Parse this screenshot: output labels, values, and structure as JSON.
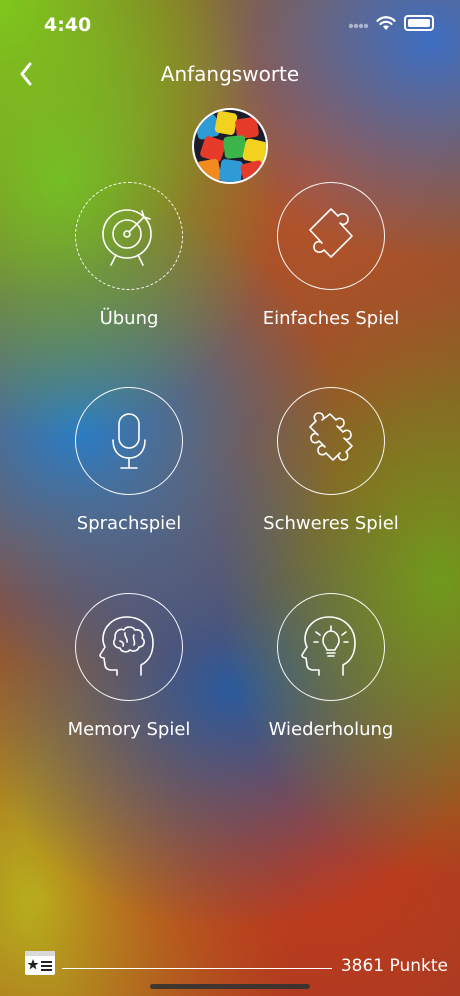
{
  "status": {
    "time": "4:40"
  },
  "nav": {
    "title": "Anfangsworte"
  },
  "modes": [
    {
      "label": "Übung",
      "icon": "target-icon"
    },
    {
      "label": "Einfaches Spiel",
      "icon": "puzzle-piece-icon"
    },
    {
      "label": "Sprachspiel",
      "icon": "microphone-icon"
    },
    {
      "label": "Schweres Spiel",
      "icon": "puzzle-complex-icon"
    },
    {
      "label": "Memory Spiel",
      "icon": "brain-head-icon"
    },
    {
      "label": "Wiederholung",
      "icon": "lightbulb-head-icon"
    }
  ],
  "footer": {
    "points": "3861 Punkte"
  },
  "colors": {
    "foreground": "#ffffff"
  }
}
